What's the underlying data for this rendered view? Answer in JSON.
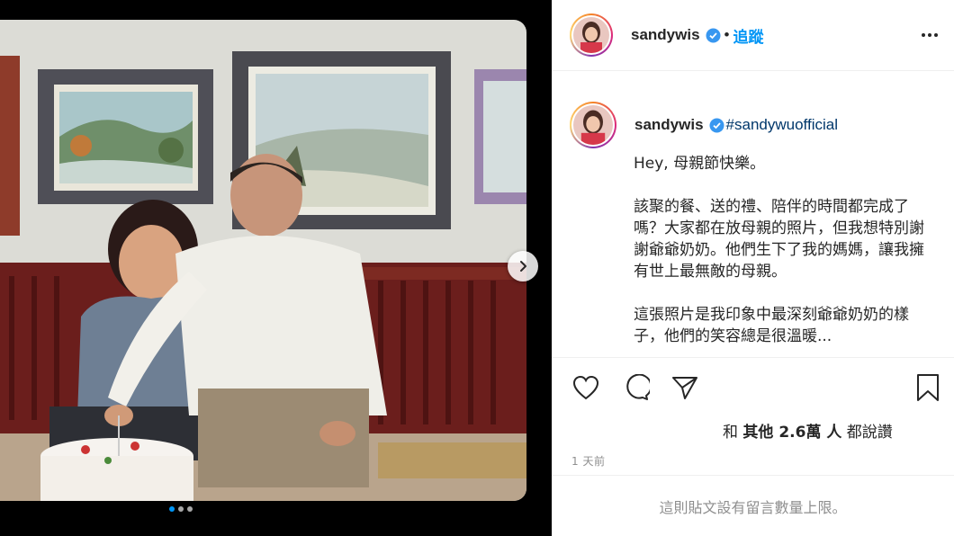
{
  "post": {
    "username": "sandywis",
    "separator": "•",
    "follow_label": "追蹤",
    "hashtag": "#sandywuofficial",
    "caption": "Hey, 母親節快樂。\n\n該聚的餐、送的禮、陪伴的時間都完成了嗎？大家都在放母親的照片，但我想特別謝謝爺爺奶奶。他們生下了我的媽媽，讓我擁有世上最無敵的母親。\n\n這張照片是我印象中最深刻爺爺奶奶的樣子，他們的笑容總是很溫暖...",
    "likes_prefix": "和",
    "likes_bold": "其他 2.6萬 人",
    "likes_suffix": "都說讚",
    "timestamp": "1 天前",
    "comments_disabled": "這則貼文設有留言數量上限。"
  },
  "carousel": {
    "count": 3,
    "active": 0
  },
  "icons": {
    "verified": "verified-badge-icon",
    "more": "more-options-icon",
    "like": "heart-icon",
    "comment": "comment-icon",
    "share": "share-icon",
    "save": "bookmark-icon",
    "next": "chevron-right-icon"
  },
  "colors": {
    "link": "#0095f6",
    "hashtag": "#00376b",
    "text": "#262626",
    "muted": "#8e8e8e"
  }
}
